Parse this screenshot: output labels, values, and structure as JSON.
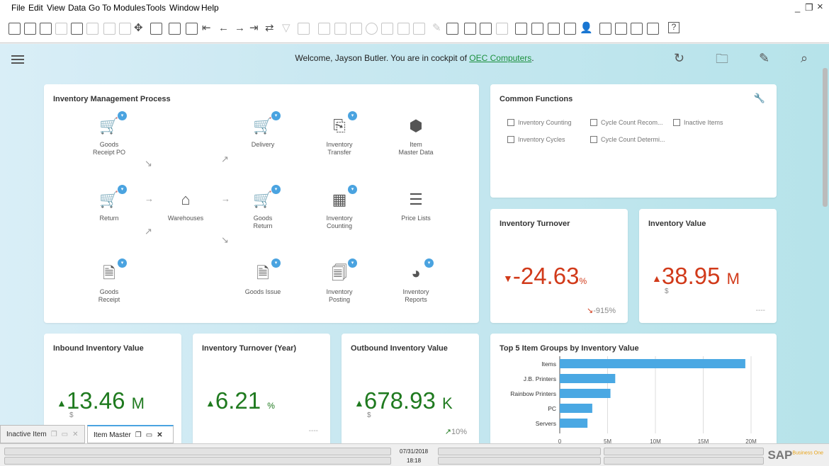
{
  "menu": [
    "File",
    "Edit",
    "View",
    "Data",
    "Go To",
    "Modules",
    "Tools",
    "Window",
    "Help"
  ],
  "window_controls": {
    "minimize": "_",
    "restore": "❐",
    "close": "×"
  },
  "header": {
    "welcome_prefix": "Welcome, Jayson Butler. You are in cockpit of ",
    "company": "OEC Computers",
    "welcome_suffix": "."
  },
  "process": {
    "title": "Inventory Management Process",
    "items": {
      "goods_receipt_po": "Goods\nReceipt PO",
      "delivery": "Delivery",
      "inventory_transfer": "Inventory\nTransfer",
      "item_master_data": "Item\nMaster Data",
      "return": "Return",
      "warehouses": "Warehouses",
      "goods_return": "Goods\nReturn",
      "inventory_counting": "Inventory\nCounting",
      "price_lists": "Price Lists",
      "goods_receipt": "Goods\nReceipt",
      "goods_issue": "Goods Issue",
      "inventory_posting": "Inventory\nPosting",
      "inventory_reports": "Inventory\nReports"
    }
  },
  "common": {
    "title": "Common Functions",
    "items": [
      "Inventory Counting",
      "Cycle Count Recom...",
      "Inactive Items",
      "Inventory Cycles",
      "Cycle Count Determi..."
    ]
  },
  "kpis": {
    "turnover": {
      "title": "Inventory Turnover",
      "value": "-24.63",
      "unit": "%",
      "foot": "-915%"
    },
    "value": {
      "title": "Inventory Value",
      "value": "38.95",
      "unit": "M",
      "currency": "$",
      "foot": "----"
    },
    "inbound": {
      "title": "Inbound Inventory Value",
      "value": "13.46",
      "unit": "M",
      "currency": "$"
    },
    "turnover_year": {
      "title": "Inventory Turnover (Year)",
      "value": "6.21",
      "unit": "%",
      "foot": "----"
    },
    "outbound": {
      "title": "Outbound Inventory Value",
      "value": "678.93",
      "unit": "K",
      "currency": "$",
      "foot": "10%"
    }
  },
  "chart_data": {
    "type": "bar",
    "orientation": "horizontal",
    "title": "Top 5 Item Groups by Inventory Value",
    "categories": [
      "Items",
      "J.B. Printers",
      "Rainbow Printers",
      "PC",
      "Servers"
    ],
    "values": [
      19400000,
      5800000,
      5300000,
      3400000,
      2900000
    ],
    "xticks": [
      "0",
      "5M",
      "10M",
      "15M",
      "20M"
    ],
    "xlim": [
      0,
      20000000
    ],
    "bar_color": "#4aa8e3"
  },
  "tabs": [
    {
      "label": "Inactive Item"
    },
    {
      "label": "Item Master"
    }
  ],
  "status": {
    "date": "07/31/2018",
    "time": "18:18"
  },
  "brand": {
    "name": "SAP",
    "product": "Business One"
  }
}
